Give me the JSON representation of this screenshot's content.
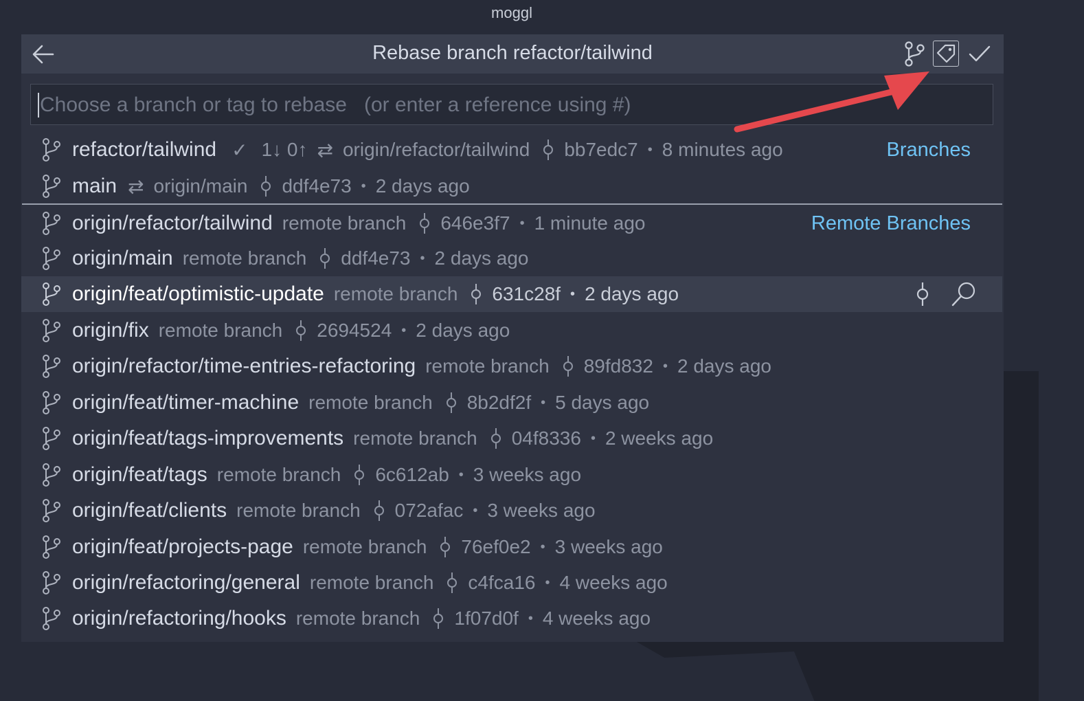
{
  "window": {
    "title": "moggl"
  },
  "quickpick": {
    "title": "Rebase branch refactor/tailwind",
    "search_placeholder": "Choose a branch or tag to rebase   (or enter a reference using #)",
    "toolbar": {
      "icons": [
        "git-branch-icon",
        "tag-icon",
        "check-icon"
      ]
    }
  },
  "branches": {
    "group_label": "Branches",
    "items": [
      {
        "name": "refactor/tailwind",
        "status": "1↓ 0↑",
        "upstream": "origin/refactor/tailwind",
        "sha": "bb7edc7",
        "age": "8 minutes ago"
      },
      {
        "name": "main",
        "upstream": "origin/main",
        "sha": "ddf4e73",
        "age": "2 days ago"
      }
    ]
  },
  "remote_branches": {
    "group_label": "Remote Branches",
    "kind_label": "remote branch",
    "items": [
      {
        "name": "origin/refactor/tailwind",
        "sha": "646e3f7",
        "age": "1 minute ago"
      },
      {
        "name": "origin/main",
        "sha": "ddf4e73",
        "age": "2 days ago"
      },
      {
        "name": "origin/feat/optimistic-update",
        "sha": "631c28f",
        "age": "2 days ago"
      },
      {
        "name": "origin/fix",
        "sha": "2694524",
        "age": "2 days ago"
      },
      {
        "name": "origin/refactor/time-entries-refactoring",
        "sha": "89fd832",
        "age": "2 days ago"
      },
      {
        "name": "origin/feat/timer-machine",
        "sha": "8b2df2f",
        "age": "5 days ago"
      },
      {
        "name": "origin/feat/tags-improvements",
        "sha": "04f8336",
        "age": "2 weeks ago"
      },
      {
        "name": "origin/feat/tags",
        "sha": "6c612ab",
        "age": "3 weeks ago"
      },
      {
        "name": "origin/feat/clients",
        "sha": "072afac",
        "age": "3 weeks ago"
      },
      {
        "name": "origin/feat/projects-page",
        "sha": "76ef0e2",
        "age": "3 weeks ago"
      },
      {
        "name": "origin/refactoring/general",
        "sha": "c4fca16",
        "age": "4 weeks ago"
      },
      {
        "name": "origin/refactoring/hooks",
        "sha": "1f07d0f",
        "age": "4 weeks ago"
      }
    ]
  },
  "glyphs": {
    "check": "✓",
    "sync": "⇄",
    "dot": "•"
  },
  "colors": {
    "accent": "#6fc3f4",
    "annotation_arrow": "#e5484d",
    "panel": "#2e3240"
  }
}
